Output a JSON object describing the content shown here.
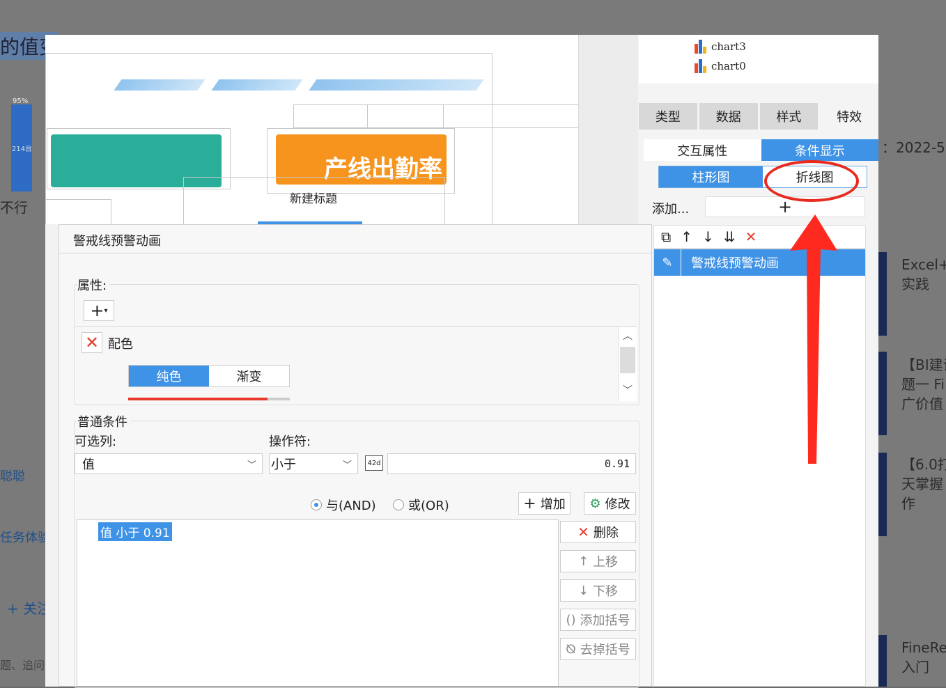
{
  "background": {
    "heading_fragment": "的值变",
    "label_95": "95%",
    "label_214": "214台",
    "not_ok": "不行",
    "cong": "聪聪",
    "task": "任务体验",
    "add_follow": "+ 关注",
    "ask": "题、追问",
    "date": "：2022-5",
    "articles": [
      {
        "line1": "Excel+",
        "line2": "实践",
        "line3": ""
      },
      {
        "line1": "【BI建设",
        "line2": "题一 Fi",
        "line3": "广价值"
      },
      {
        "line1": "【6.0打",
        "line2": "天掌握",
        "line3": "作"
      },
      {
        "line1": "FineRe",
        "line2": "入门",
        "line3": ""
      }
    ]
  },
  "canvas": {
    "orange_card_text": "产线出勤率",
    "new_title": "新建标题"
  },
  "right_panel": {
    "tree": [
      {
        "label": "chart3",
        "icon": "bar-chart-icon"
      },
      {
        "label": "chart0",
        "icon": "bar-chart-icon"
      }
    ],
    "tabs": [
      "类型",
      "数据",
      "样式",
      "特效"
    ],
    "subtabs": {
      "left": "交互属性",
      "right": "条件显示"
    },
    "chart_types": {
      "bar": "柱形图",
      "line": "折线图"
    },
    "add_label": "添加...",
    "add_symbol": "+",
    "list_items": [
      "警戒线预警动画"
    ]
  },
  "dialog": {
    "title": "警戒线预警动画",
    "props_label": "属性:",
    "color_label": "配色",
    "solid": "纯色",
    "gradient": "渐变",
    "normal_condition": "普通条件",
    "column_label": "可选列:",
    "operator_label": "操作符:",
    "column_value": "值",
    "operator_value": "小于",
    "value_input": "0.91",
    "radio_and": "与(AND)",
    "radio_or": "或(OR)",
    "btn_add": "增加",
    "btn_modify": "修改",
    "btn_delete": "删除",
    "btn_up": "上移",
    "btn_down": "下移",
    "btn_add_paren": "添加括号",
    "btn_remove_paren": "去掉括号",
    "condition_item": "值 小于 0.91"
  },
  "colors": {
    "accent": "#3f93e6",
    "annotation": "#e82a1f",
    "orange": "#f7941e",
    "teal": "#2aae9a"
  }
}
